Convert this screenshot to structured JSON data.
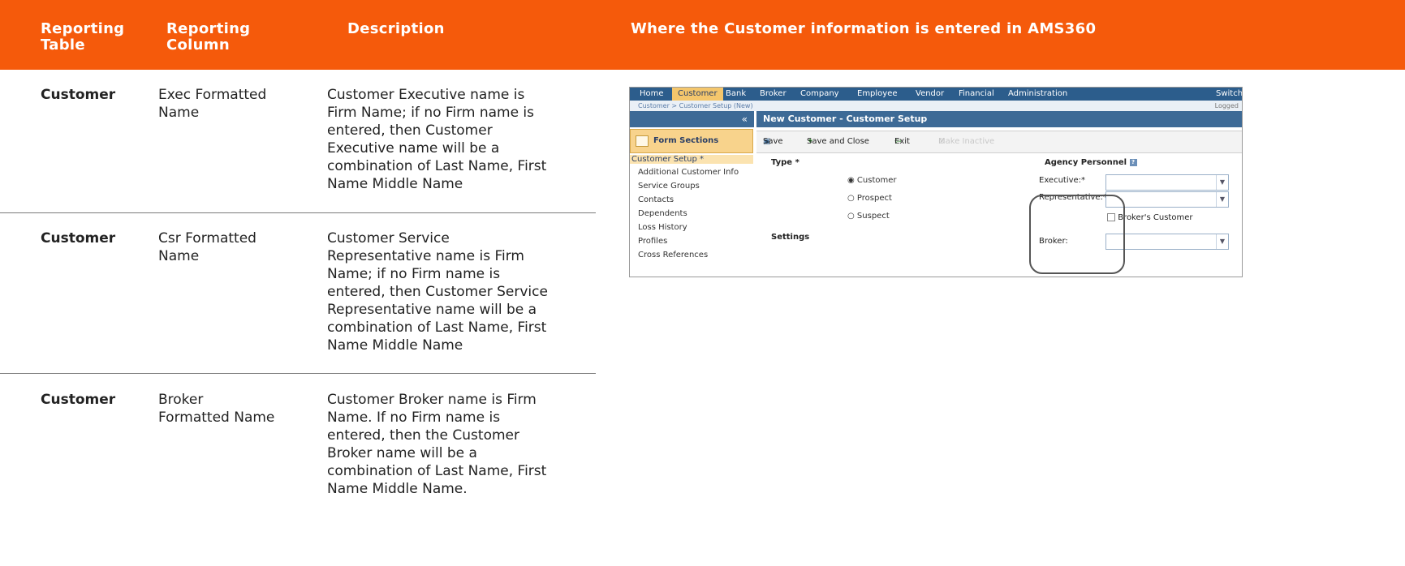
{
  "header": {
    "col_table": "Reporting\nTable",
    "col_column": "Reporting\nColumn",
    "col_description": "Description",
    "col_where": "Where the Customer information is entered in AMS360"
  },
  "rows": [
    {
      "table": "Customer",
      "column": "Exec Formatted\nName",
      "description": "Customer Executive name is\nFirm Name; if no Firm name is\nentered, then Customer\nExecutive name will be a\ncombination of Last Name, First\nName Middle Name"
    },
    {
      "table": "Customer",
      "column": "Csr Formatted\nName",
      "description": "Customer Service\nRepresentative name is Firm\nName; if no Firm name is\nentered, then Customer Service\nRepresentative name will be a\ncombination of Last Name, First\nName Middle Name"
    },
    {
      "table": "Customer",
      "column": "Broker\nFormatted Name",
      "description": "Customer Broker name is Firm\nName. If no Firm name is\nentered, then the Customer\nBroker name will be a\ncombination of Last Name, First\nName Middle Name."
    }
  ],
  "screenshot": {
    "menu": [
      "Home",
      "Customer",
      "Bank",
      "Broker",
      "Company",
      "Employee",
      "Vendor",
      "Financial",
      "Administration",
      "Switch"
    ],
    "breadcrumb": "Customer  >  Customer Setup (New)",
    "logged": "Logged",
    "collapse_icon": "«",
    "form_sections": "Form Sections",
    "nav_items": [
      "Customer Setup *",
      "Additional Customer Info",
      "Service Groups",
      "Contacts",
      "Dependents",
      "Loss History",
      "Profiles",
      "Cross References"
    ],
    "page_title": "New Customer - Customer Setup",
    "toolbar": {
      "save": "Save",
      "save_close": "Save and Close",
      "exit": "Exit",
      "make_inactive": "Make Inactive"
    },
    "type_label": "Type *",
    "type_options": [
      "Customer",
      "Prospect",
      "Suspect"
    ],
    "settings_label": "Settings",
    "agency_personnel": "Agency Personnel",
    "executive_label": "Executive:*",
    "representative_label": "Representative:*",
    "brokers_customer": "Broker's Customer",
    "broker_label": "Broker:"
  }
}
